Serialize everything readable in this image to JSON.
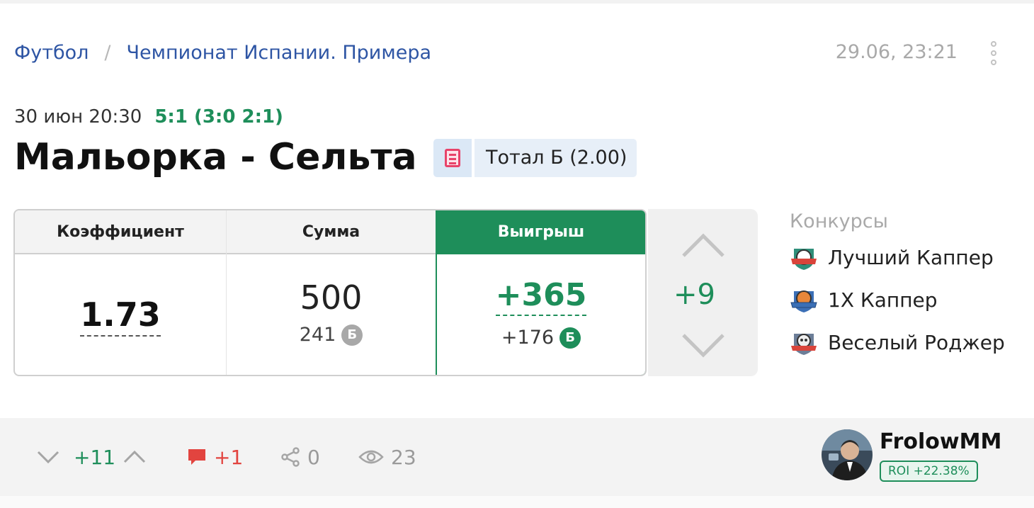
{
  "breadcrumb": {
    "sport": "Футбол",
    "separator": "/",
    "league": "Чемпионат Испании. Примера"
  },
  "posted_at": "29.06, 23:21",
  "match": {
    "datetime": "30 июн 20:30",
    "score": "5:1 (3:0 2:1)",
    "teams": "Мальорка - Сельта",
    "bet_label": "Тотал Б (2.00)"
  },
  "bet": {
    "headers": {
      "odds": "Коэффициент",
      "stake": "Сумма",
      "win": "Выигрыш"
    },
    "odds": "1.73",
    "stake": "500",
    "stake_bonus": "241",
    "win": "+365",
    "win_bonus": "+176",
    "bonus_icon": "Б"
  },
  "rating": {
    "value": "+9"
  },
  "contests": {
    "title": "Конкурсы",
    "items": [
      {
        "label": "Лучший Каппер",
        "icon": "ball-badge-icon"
      },
      {
        "label": "1X Каппер",
        "icon": "basketball-badge-icon"
      },
      {
        "label": "Веселый Роджер",
        "icon": "skull-badge-icon"
      }
    ]
  },
  "footer": {
    "votes": "+11",
    "comments": "+1",
    "shares": "0",
    "views": "23"
  },
  "user": {
    "name": "FrolowMM",
    "roi": "ROI +22.38%"
  },
  "colors": {
    "accent_green": "#1e8e5a",
    "link_blue": "#2e55a4",
    "comment_red": "#e2443f"
  }
}
